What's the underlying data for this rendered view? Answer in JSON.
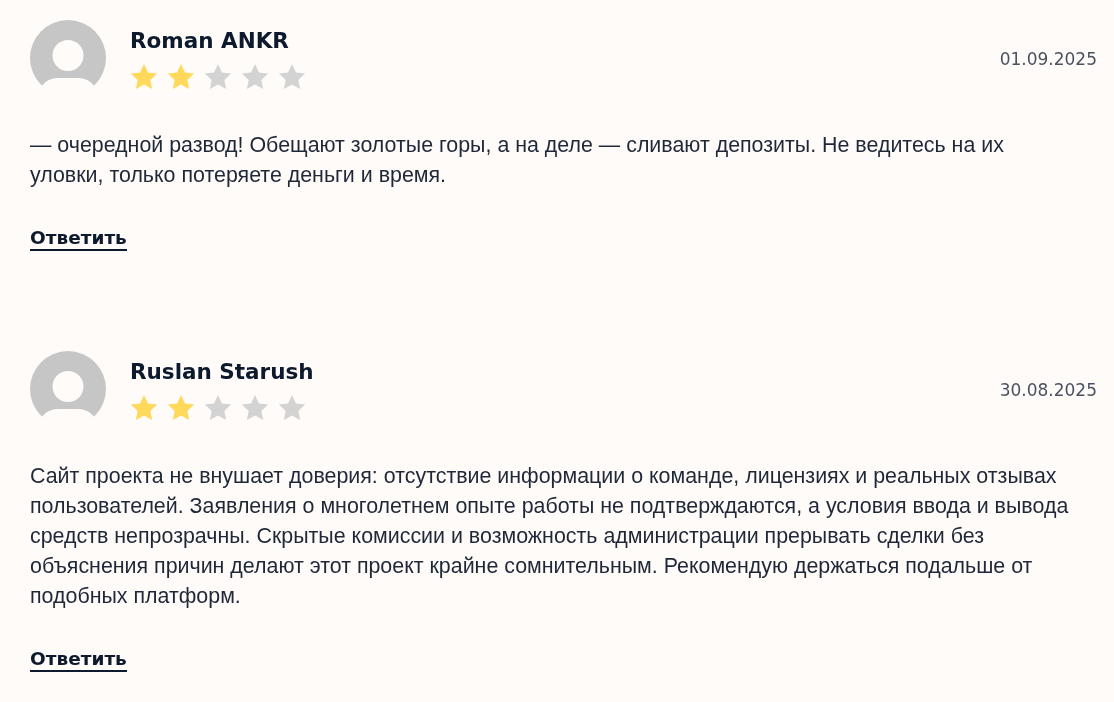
{
  "reviews": [
    {
      "author": "Roman ANKR",
      "stars": 2,
      "date": "01.09.2025",
      "text": "— очередной развод! Обещают золотые горы, а на деле — сливают депозиты. Не ведитесь на их уловки, только потеряете деньги и время.",
      "reply": "Ответить"
    },
    {
      "author": "Ruslan Starush",
      "stars": 2,
      "date": "30.08.2025",
      "text": "Сайт проекта не внушает доверия: отсутствие информации о команде, лицензиях и реальных отзывах пользователей. Заявления о многолетнем опыте работы не подтверждаются, а условия ввода и вывода средств непрозрачны. Скрытые комиссии и возможность администрации прерывать сделки без объяснения причин делают этот проект крайне сомнительным. Рекомендую держаться подальше от подобных платформ.",
      "reply": "Ответить"
    }
  ]
}
